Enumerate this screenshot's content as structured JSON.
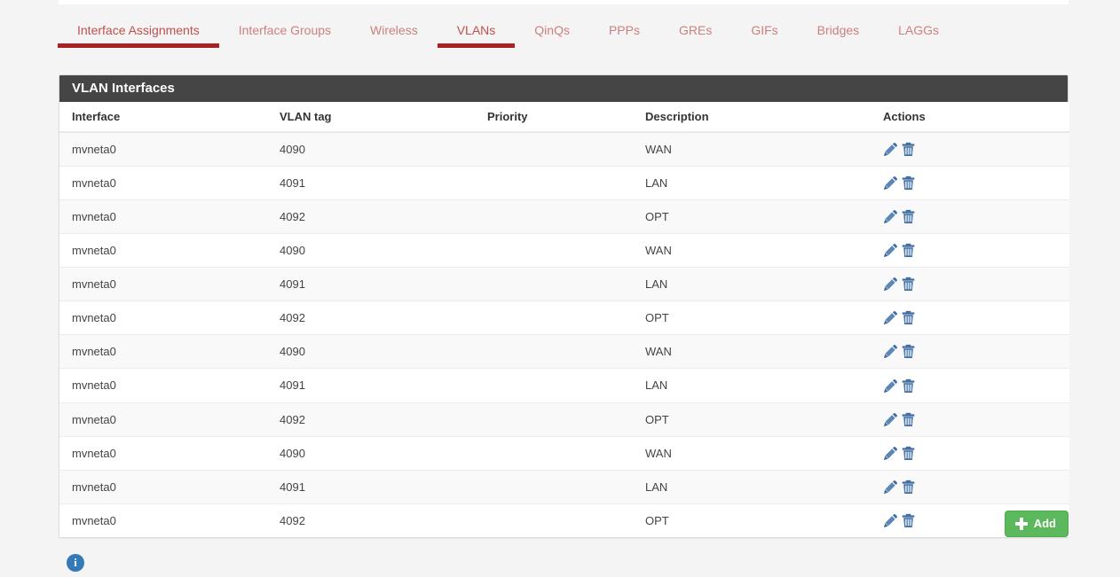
{
  "tabs": [
    {
      "label": "Interface Assignments",
      "active": true
    },
    {
      "label": "Interface Groups",
      "active": false
    },
    {
      "label": "Wireless",
      "active": false
    },
    {
      "label": "VLANs",
      "active": true
    },
    {
      "label": "QinQs",
      "active": false
    },
    {
      "label": "PPPs",
      "active": false
    },
    {
      "label": "GREs",
      "active": false
    },
    {
      "label": "GIFs",
      "active": false
    },
    {
      "label": "Bridges",
      "active": false
    },
    {
      "label": "LAGGs",
      "active": false
    }
  ],
  "panel": {
    "title": "VLAN Interfaces",
    "columns": [
      "Interface",
      "VLAN tag",
      "Priority",
      "Description",
      "Actions"
    ],
    "rows": [
      {
        "interface": "mvneta0",
        "vlan_tag": "4090",
        "priority": "",
        "description": "WAN"
      },
      {
        "interface": "mvneta0",
        "vlan_tag": "4091",
        "priority": "",
        "description": "LAN"
      },
      {
        "interface": "mvneta0",
        "vlan_tag": "4092",
        "priority": "",
        "description": "OPT"
      },
      {
        "interface": "mvneta0",
        "vlan_tag": "4090",
        "priority": "",
        "description": "WAN"
      },
      {
        "interface": "mvneta0",
        "vlan_tag": "4091",
        "priority": "",
        "description": "LAN"
      },
      {
        "interface": "mvneta0",
        "vlan_tag": "4092",
        "priority": "",
        "description": "OPT"
      },
      {
        "interface": "mvneta0",
        "vlan_tag": "4090",
        "priority": "",
        "description": "WAN"
      },
      {
        "interface": "mvneta0",
        "vlan_tag": "4091",
        "priority": "",
        "description": "LAN"
      },
      {
        "interface": "mvneta0",
        "vlan_tag": "4092",
        "priority": "",
        "description": "OPT"
      },
      {
        "interface": "mvneta0",
        "vlan_tag": "4090",
        "priority": "",
        "description": "WAN"
      },
      {
        "interface": "mvneta0",
        "vlan_tag": "4091",
        "priority": "",
        "description": "LAN"
      },
      {
        "interface": "mvneta0",
        "vlan_tag": "4092",
        "priority": "",
        "description": "OPT"
      }
    ],
    "row_actions": [
      {
        "icon": "pencil-icon"
      },
      {
        "icon": "trash-icon"
      }
    ]
  },
  "add_button": {
    "label": "Add",
    "icon": "plus-icon"
  },
  "info_button": {
    "icon": "info-icon",
    "glyph": "i"
  },
  "colors": {
    "page_background": "#f4f4f4",
    "panel_heading_background": "#454545",
    "tab_text": "#cd7f7f",
    "tab_active_underline": "#ab2121",
    "action_icon": "#3f6b9e",
    "add_button": "#5cb85c",
    "info_icon": "#337ab7",
    "row_stripe": "#f9f9f9"
  }
}
